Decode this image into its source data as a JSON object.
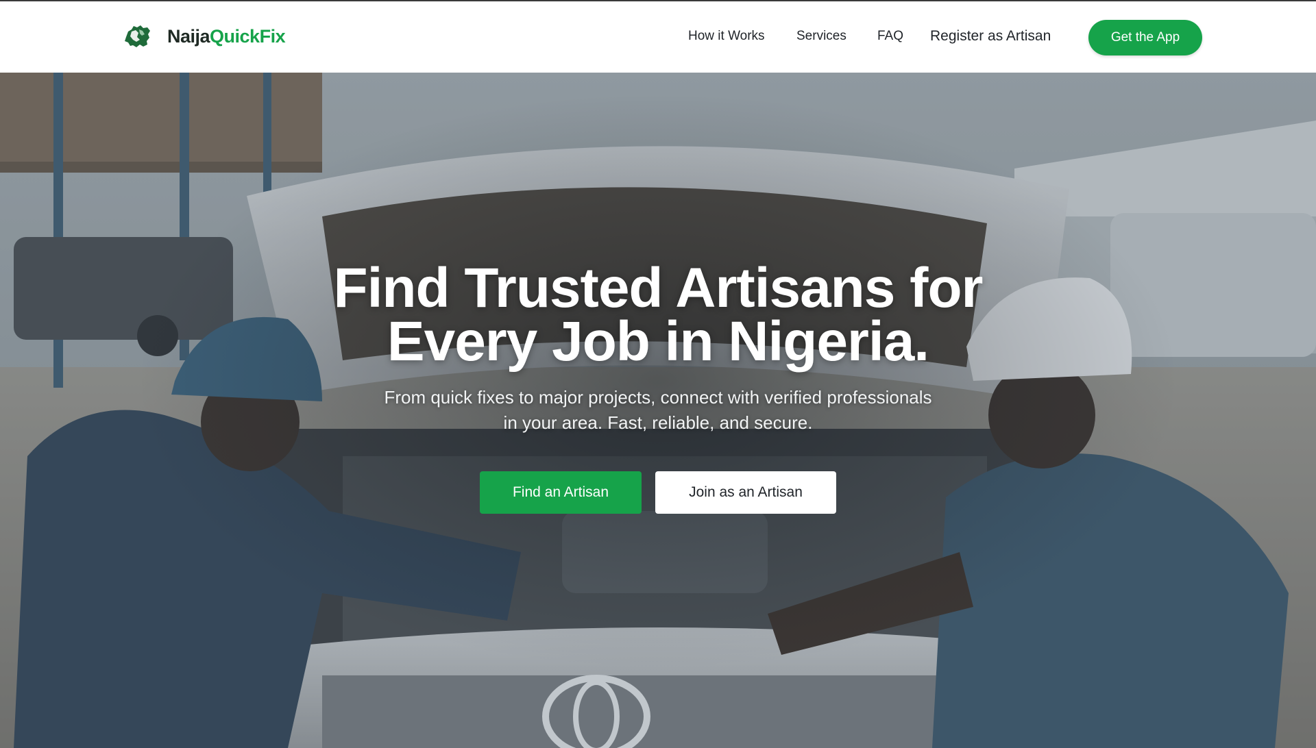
{
  "brand": {
    "name_part1": "Naija",
    "name_part2": "QuickFix",
    "accent_color": "#16a34a",
    "logo_icon": "nigeria-map-logo-icon"
  },
  "nav": {
    "how_it_works": "How it Works",
    "services": "Services",
    "faq": "FAQ",
    "register": "Register as Artisan",
    "get_app": "Get the App"
  },
  "hero": {
    "title_line1": "Find Trusted Artisans for",
    "title_line2": "Every Job in Nigeria.",
    "subtitle_line1": "From quick fixes to major projects, connect with verified professionals",
    "subtitle_line2": "in your area. Fast, reliable, and secure.",
    "primary_cta": "Find an Artisan",
    "secondary_cta": "Join as an Artisan",
    "background_image": "two mechanics in hard hats working under the open hood of a white Toyota"
  }
}
